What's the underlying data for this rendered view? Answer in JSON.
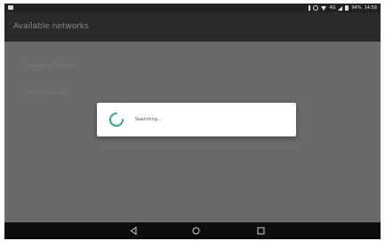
{
  "status_bar": {
    "network_type": "4G",
    "battery_percent": "94%",
    "time": "14:59"
  },
  "app_bar": {
    "title": "Available networks"
  },
  "networks": [
    {
      "title": "Bouygues Telecom",
      "subtitle": ""
    },
    {
      "title": "Orange Caraibe",
      "subtitle": ""
    }
  ],
  "dialog": {
    "message": "Searching...",
    "accent_color": "#26a69a"
  },
  "nav": {
    "back_icon": "back-triangle-icon",
    "home_icon": "home-circle-icon",
    "recents_icon": "recents-square-icon"
  }
}
